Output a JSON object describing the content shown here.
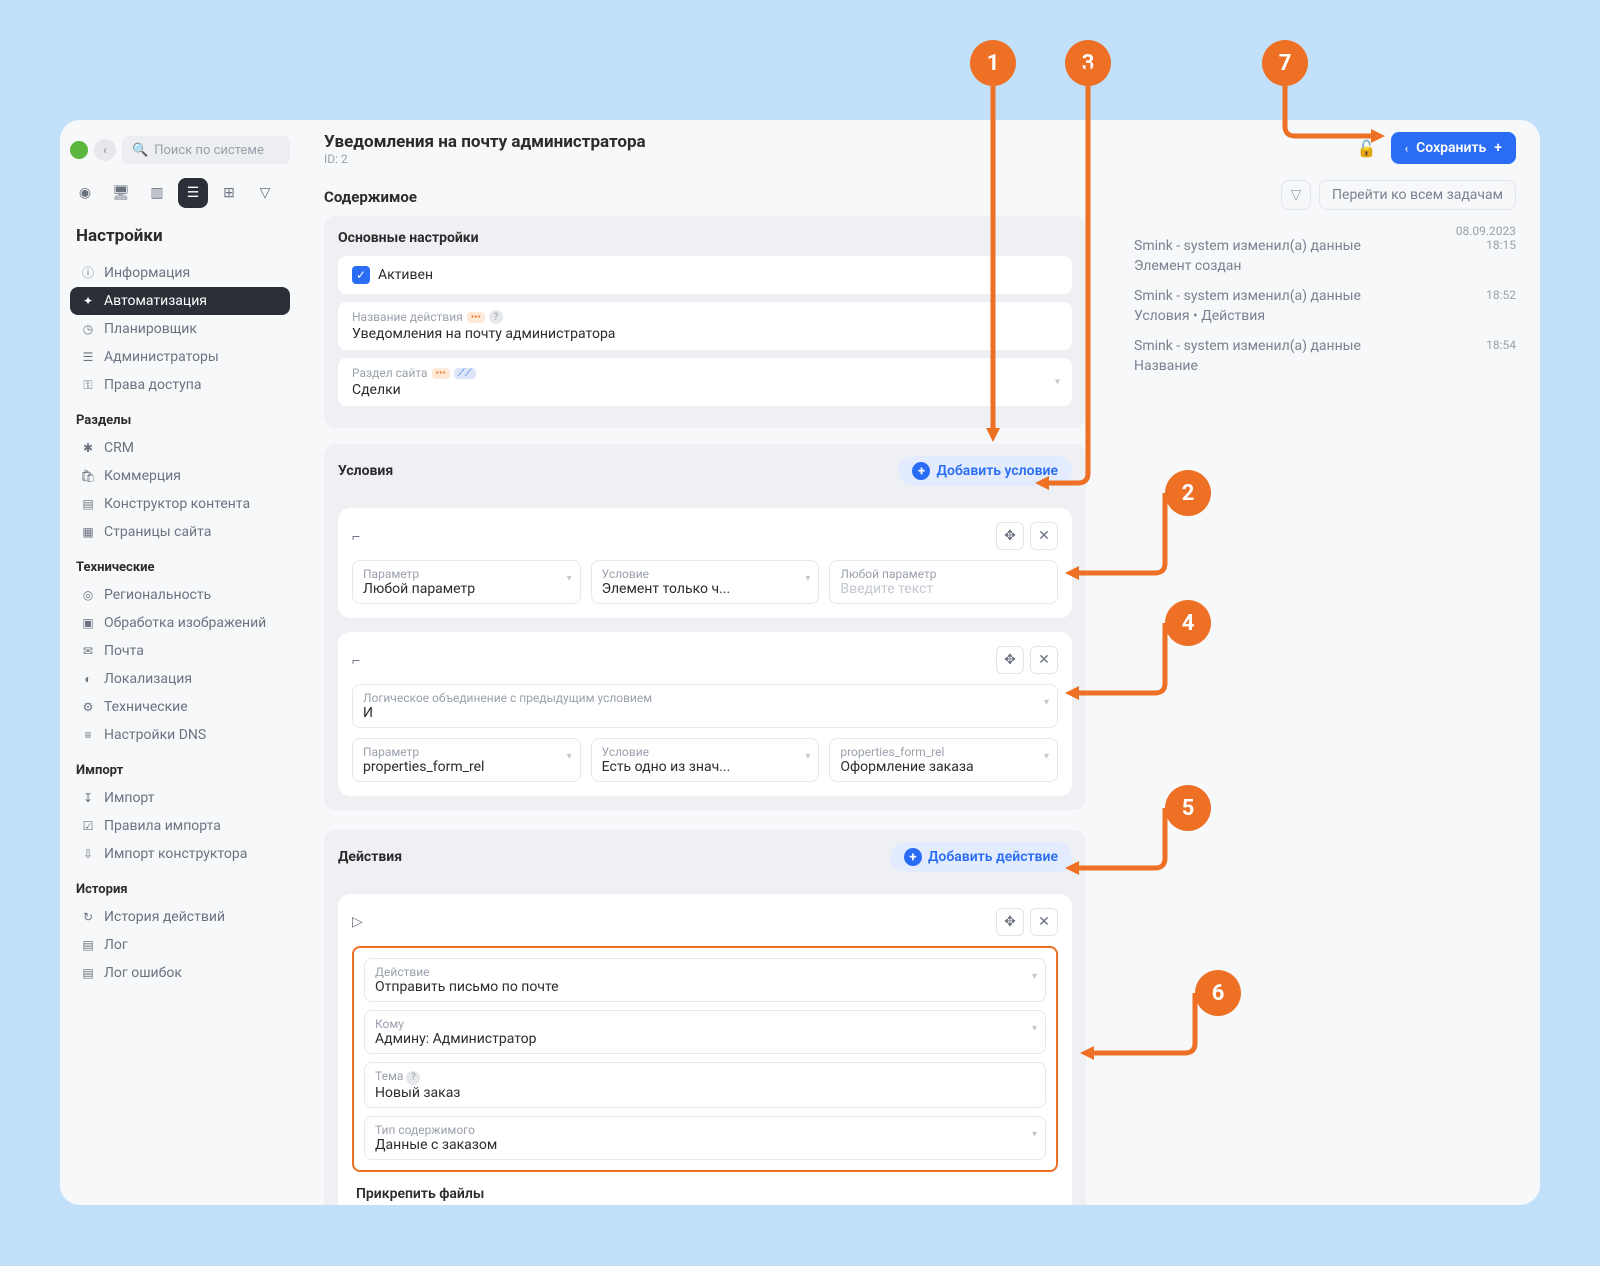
{
  "search_placeholder": "Поиск по системе",
  "sidebar": {
    "title": "Настройки",
    "groups": [
      {
        "items": [
          {
            "icon": "ⓘ",
            "label": "Информация"
          },
          {
            "icon": "✦",
            "label": "Автоматизация",
            "active": true
          },
          {
            "icon": "◷",
            "label": "Планировщик"
          },
          {
            "icon": "☰",
            "label": "Администраторы"
          },
          {
            "icon": "⚿",
            "label": "Права доступа"
          }
        ]
      },
      {
        "title": "Разделы",
        "items": [
          {
            "icon": "✱",
            "label": "CRM"
          },
          {
            "icon": "🛍",
            "label": "Коммерция"
          },
          {
            "icon": "▤",
            "label": "Конструктор контента"
          },
          {
            "icon": "▦",
            "label": "Страницы сайта"
          }
        ]
      },
      {
        "title": "Технические",
        "items": [
          {
            "icon": "◎",
            "label": "Региональность"
          },
          {
            "icon": "▣",
            "label": "Обработка изображений"
          },
          {
            "icon": "✉",
            "label": "Почта"
          },
          {
            "icon": "◐",
            "label": "Локализация"
          },
          {
            "icon": "⚙",
            "label": "Технические"
          },
          {
            "icon": "≡",
            "label": "Настройки DNS"
          }
        ]
      },
      {
        "title": "Импорт",
        "items": [
          {
            "icon": "↧",
            "label": "Импорт"
          },
          {
            "icon": "☑",
            "label": "Правила импорта"
          },
          {
            "icon": "⇩",
            "label": "Импорт конструктора"
          }
        ]
      },
      {
        "title": "История",
        "items": [
          {
            "icon": "↻",
            "label": "История действий"
          },
          {
            "icon": "▤",
            "label": "Лог"
          },
          {
            "icon": "▤",
            "label": "Лог ошибок"
          }
        ]
      }
    ]
  },
  "header": {
    "title": "Уведомления на почту администратора",
    "sub": "ID: 2",
    "save_label": "Сохранить"
  },
  "content_title": "Содержимое",
  "basic": {
    "title": "Основные настройки",
    "active_label": "Активен",
    "name_label": "Название действия",
    "name_value": "Уведомления на почту администратора",
    "section_label": "Раздел сайта",
    "section_value": "Сделки"
  },
  "conditions": {
    "title": "Условия",
    "add_label": "Добавить условие",
    "block1": {
      "param_label": "Параметр",
      "param_value": "Любой параметр",
      "cond_label": "Условие",
      "cond_value": "Элемент только ч...",
      "any_label": "Любой параметр",
      "any_placeholder": "Введите текст"
    },
    "block2": {
      "logic_label": "Логическое объединение с предыдущим условием",
      "logic_value": "И",
      "param_label": "Параметр",
      "param_value": "properties_form_rel",
      "cond_label": "Условие",
      "cond_value": "Есть одно из знач...",
      "val_label": "properties_form_rel",
      "val_value": "Оформление заказа"
    }
  },
  "actions": {
    "title": "Действия",
    "add_label": "Добавить действие",
    "action_label": "Действие",
    "action_value": "Отправить письмо по почте",
    "to_label": "Кому",
    "to_value": "Админу: Администратор",
    "subj_label": "Тема",
    "subj_value": "Новый заказ",
    "type_label": "Тип содержимого",
    "type_value": "Данные с заказом",
    "attach_label": "Прикрепить файлы"
  },
  "tasks": {
    "go_label": "Перейти ко всем задачам",
    "logs": [
      {
        "date": "08.09.2023",
        "time": "18:15",
        "line1": "Smink - system изменил(а) данные",
        "line2": "Элемент создан"
      },
      {
        "date": "",
        "time": "18:52",
        "line1": "Smink - system изменил(а) данные",
        "line2": "Условия • Действия"
      },
      {
        "date": "",
        "time": "18:54",
        "line1": "Smink - system изменил(а) данные",
        "line2": "Название"
      }
    ]
  },
  "callouts": [
    "1",
    "2",
    "3",
    "4",
    "5",
    "6",
    "7"
  ]
}
